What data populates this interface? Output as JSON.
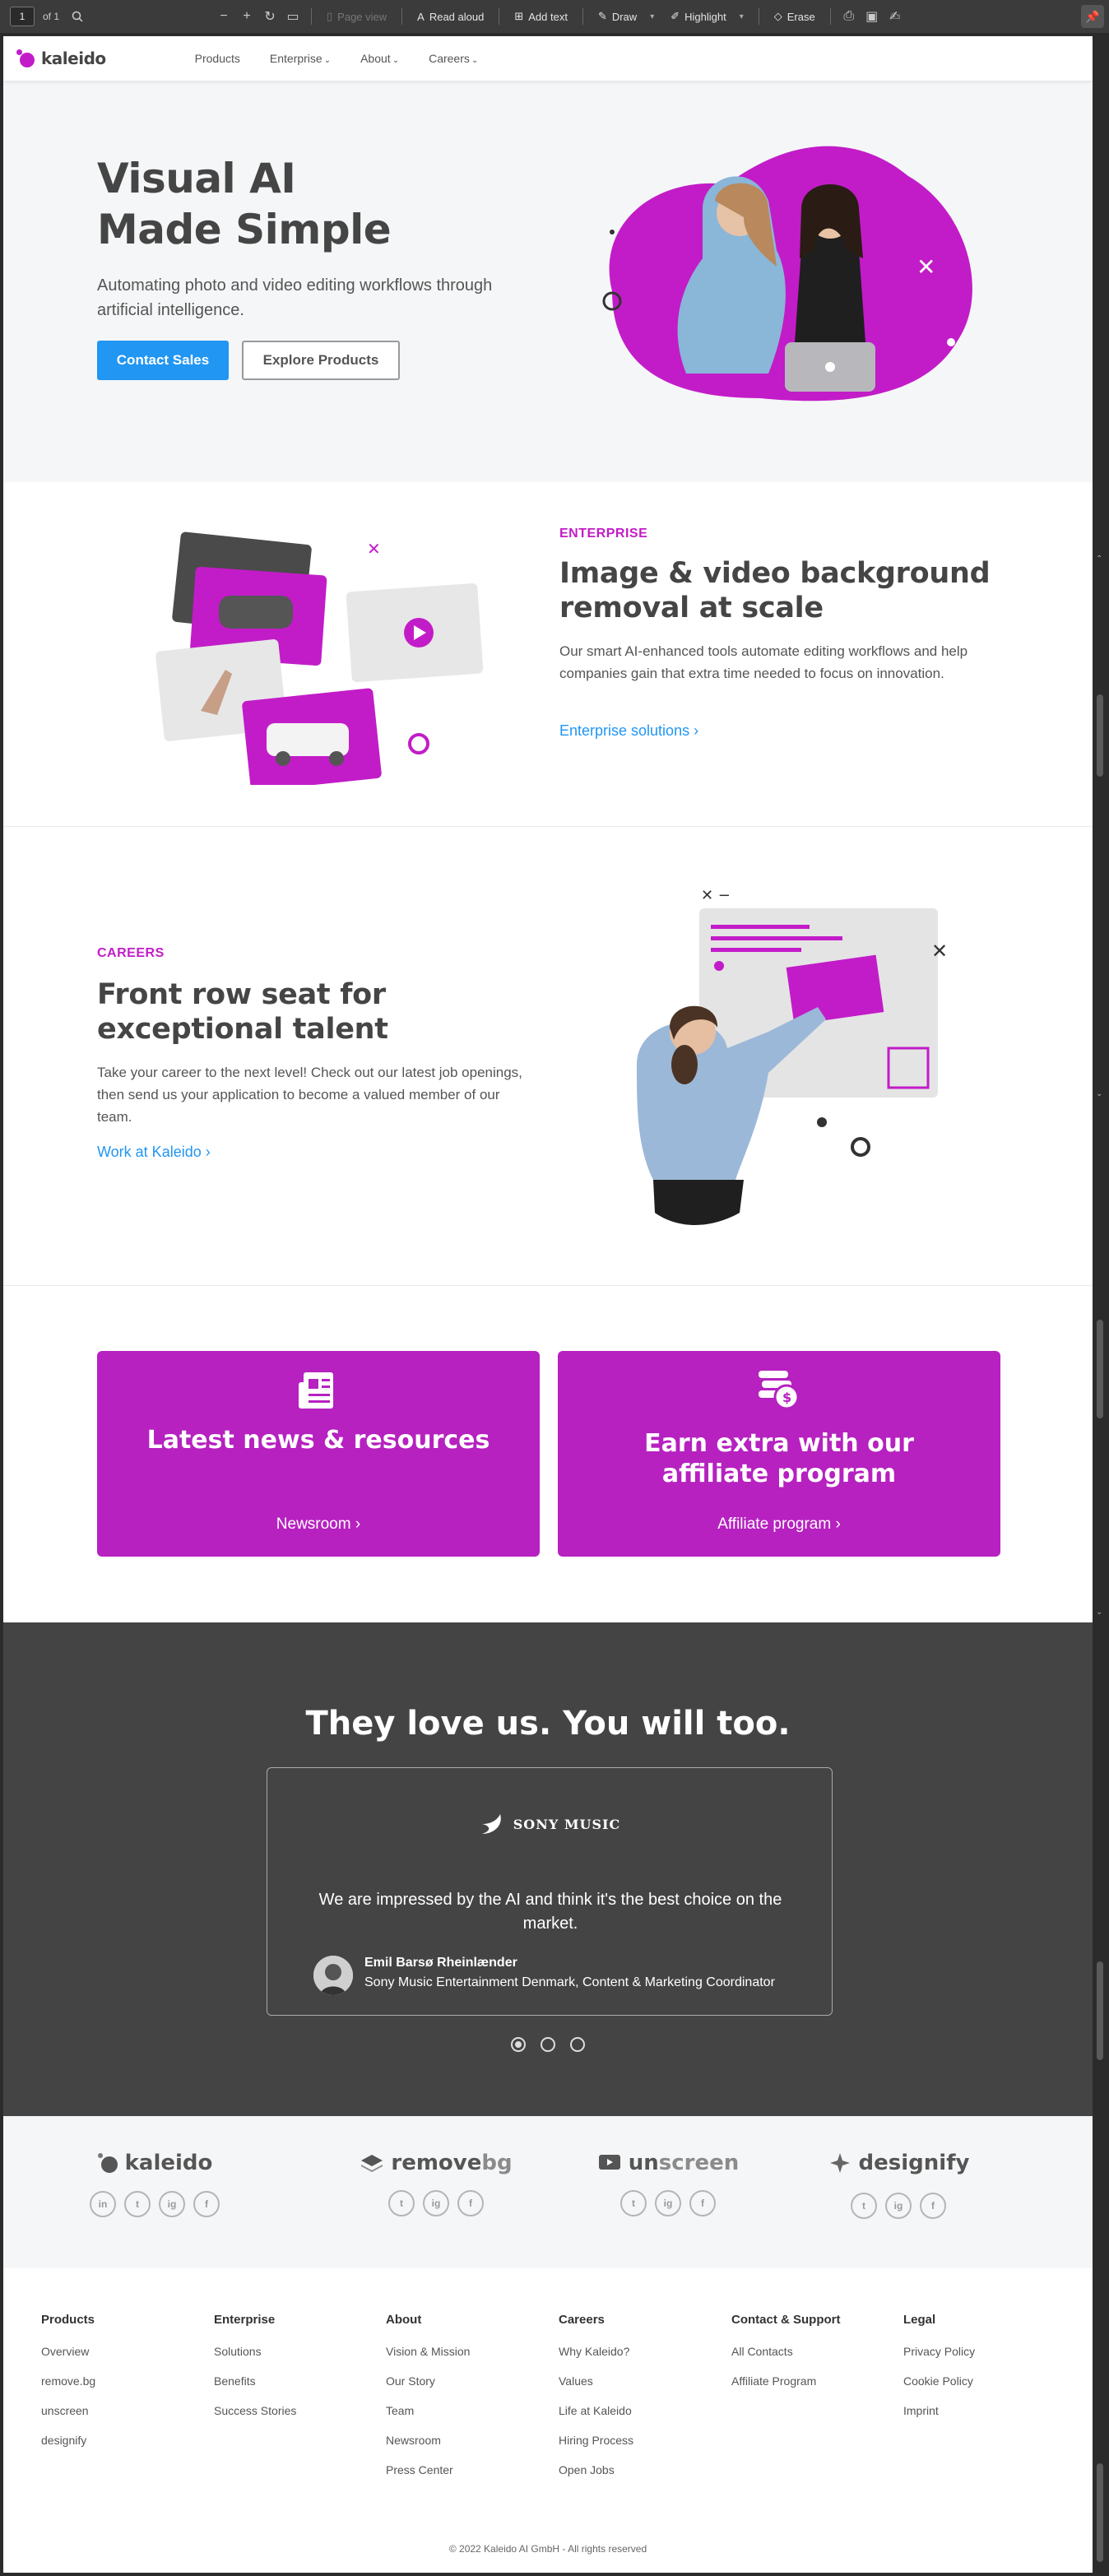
{
  "viewer": {
    "page_number": "1",
    "page_of": "of 1",
    "page_view": "Page view",
    "read_aloud": "Read aloud",
    "add_text": "Add text",
    "draw": "Draw",
    "highlight": "Highlight",
    "erase": "Erase"
  },
  "nav": {
    "brand": "kaleido",
    "links": [
      "Products",
      "Enterprise",
      "About",
      "Careers"
    ]
  },
  "hero": {
    "title_line1": "Visual AI",
    "title_line2": "Made Simple",
    "subtitle": "Automating photo and video editing workflows through artificial intelligence.",
    "primary_button": "Contact Sales",
    "secondary_button": "Explore Products"
  },
  "enterprise": {
    "label": "ENTERPRISE",
    "title": "Image & video background removal at scale",
    "text": "Our smart AI-enhanced tools automate editing workflows and help companies gain that extra time needed to focus on innovation.",
    "link": "Enterprise solutions"
  },
  "careers": {
    "label": "CAREERS",
    "title": "Front row seat for exceptional talent",
    "text": "Take your career to the next level! Check out our latest job openings, then send us your application to become a valued member of our team.",
    "link": "Work at Kaleido"
  },
  "cards": [
    {
      "title": "Latest news & resources",
      "link": "Newsroom"
    },
    {
      "title": "Earn extra with our affiliate program",
      "link": "Affiliate program"
    }
  ],
  "testimonials": {
    "heading": "They love us. You will too.",
    "company": "SONY MUSIC",
    "quote": "We are impressed by the AI and think it's the best choice on the market.",
    "name": "Emil Barsø Rheinlænder",
    "role": "Sony Music Entertainment Denmark, Content & Marketing Coordinator",
    "slides": 3,
    "active_slide": 1
  },
  "brands": [
    {
      "name_dark": "kaleido",
      "name_light": "",
      "socials": [
        "in",
        "t",
        "ig",
        "f"
      ]
    },
    {
      "name_dark": "remove",
      "name_light": "bg",
      "socials": [
        "t",
        "ig",
        "f"
      ]
    },
    {
      "name_dark": "un",
      "name_light": "screen",
      "socials": [
        "t",
        "ig",
        "f"
      ]
    },
    {
      "name_dark": "designify",
      "name_light": "",
      "socials": [
        "t",
        "ig",
        "f"
      ]
    }
  ],
  "footer": {
    "columns": [
      {
        "title": "Products",
        "items": [
          "Overview",
          "remove.bg",
          "unscreen",
          "designify"
        ]
      },
      {
        "title": "Enterprise",
        "items": [
          "Solutions",
          "Benefits",
          "Success Stories"
        ]
      },
      {
        "title": "About",
        "items": [
          "Vision & Mission",
          "Our Story",
          "Team",
          "Newsroom",
          "Press Center"
        ]
      },
      {
        "title": "Careers",
        "items": [
          "Why Kaleido?",
          "Values",
          "Life at Kaleido",
          "Hiring Process",
          "Open Jobs"
        ]
      },
      {
        "title": "Contact & Support",
        "items": [
          "All Contacts",
          "Affiliate Program"
        ]
      },
      {
        "title": "Legal",
        "items": [
          "Privacy Policy",
          "Cookie Policy",
          "Imprint"
        ]
      }
    ],
    "copyright": "© 2022 Kaleido AI GmbH - All rights reserved"
  },
  "colors": {
    "brand_magenta": "#c21cc8",
    "card_magenta": "#b621c0",
    "link_blue": "#2196f3",
    "dark_section": "#444444"
  }
}
